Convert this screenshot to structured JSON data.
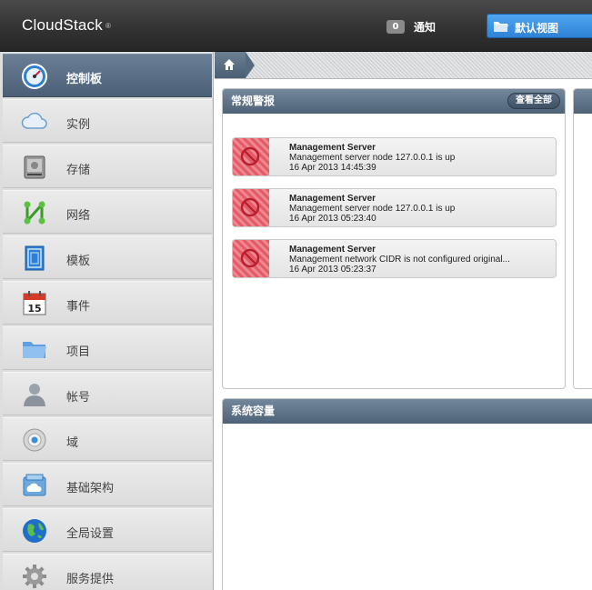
{
  "header": {
    "logo": "CloudStack",
    "logo_mark": "®",
    "notification_count": "0",
    "notification_label": "通知",
    "view_selector": "默认视图"
  },
  "sidebar": {
    "items": [
      {
        "label": "控制板",
        "icon": "dashboard-icon",
        "active": true
      },
      {
        "label": "实例",
        "icon": "cloud-icon"
      },
      {
        "label": "存储",
        "icon": "storage-icon"
      },
      {
        "label": "网络",
        "icon": "network-icon"
      },
      {
        "label": "模板",
        "icon": "template-icon"
      },
      {
        "label": "事件",
        "icon": "calendar-icon"
      },
      {
        "label": "项目",
        "icon": "folder-icon"
      },
      {
        "label": "帐号",
        "icon": "user-icon"
      },
      {
        "label": "域",
        "icon": "domain-icon"
      },
      {
        "label": "基础架构",
        "icon": "infrastructure-icon"
      },
      {
        "label": "全局设置",
        "icon": "globe-icon"
      },
      {
        "label": "服务提供",
        "icon": "gear-icon"
      }
    ]
  },
  "alerts_panel": {
    "title": "常规警报",
    "view_all": "查看全部",
    "alerts": [
      {
        "title": "Management Server",
        "message": "Management server node 127.0.0.1 is up",
        "time": "16 Apr 2013 14:45:39"
      },
      {
        "title": "Management Server",
        "message": "Management server node 127.0.0.1 is up",
        "time": "16 Apr 2013 05:23:40"
      },
      {
        "title": "Management Server",
        "message": "Management network CIDR is not configured original...",
        "time": "16 Apr 2013 05:23:37"
      }
    ]
  },
  "capacity_panel": {
    "title": "系统容量"
  },
  "colors": {
    "header_bg": "#333333",
    "nav_active": "#5a6e83",
    "view_selector": "#3b8fe0",
    "alert_stripe": "#e35d68"
  }
}
